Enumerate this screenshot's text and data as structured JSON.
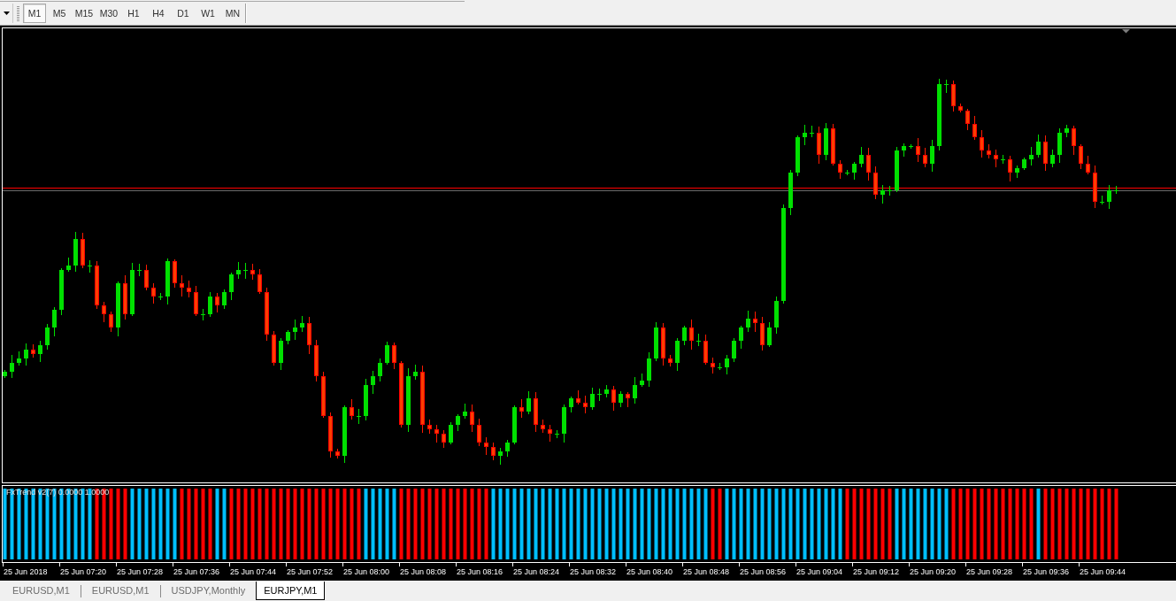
{
  "toolbar": {
    "timeframes": [
      {
        "label": "M1",
        "selected": true
      },
      {
        "label": "M5",
        "selected": false
      },
      {
        "label": "M15",
        "selected": false
      },
      {
        "label": "M30",
        "selected": false
      },
      {
        "label": "H1",
        "selected": false
      },
      {
        "label": "H4",
        "selected": false
      },
      {
        "label": "D1",
        "selected": false
      },
      {
        "label": "W1",
        "selected": false
      },
      {
        "label": "MN",
        "selected": false
      }
    ]
  },
  "chart": {
    "indicator": {
      "label": "FxTrend v2(7) 0.0000 1.0000"
    },
    "time_axis": {
      "labels": [
        "25 Jun 2018",
        "25 Jun 07:20",
        "25 Jun 07:28",
        "25 Jun 07:36",
        "25 Jun 07:44",
        "25 Jun 07:52",
        "25 Jun 08:00",
        "25 Jun 08:08",
        "25 Jun 08:16",
        "25 Jun 08:24",
        "25 Jun 08:32",
        "25 Jun 08:40",
        "25 Jun 08:48",
        "25 Jun 08:56",
        "25 Jun 09:04",
        "25 Jun 09:12",
        "25 Jun 09:20",
        "25 Jun 09:28",
        "25 Jun 09:36",
        "25 Jun 09:44"
      ]
    }
  },
  "tabs": [
    {
      "label": "EURUSD,M1",
      "selected": false
    },
    {
      "label": "EURUSD,M1",
      "selected": false
    },
    {
      "label": "USDJPY,Monthly",
      "selected": false
    },
    {
      "label": "EURJPY,M1",
      "selected": true
    }
  ]
}
